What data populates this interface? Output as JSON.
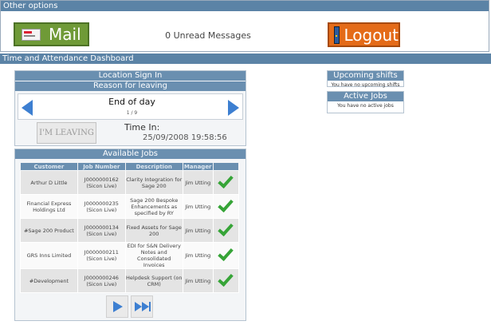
{
  "header": {
    "title": "Other options",
    "mail_label": "Mail",
    "unread": "0 Unread Messages",
    "logout_label": "Logout"
  },
  "dashboard": {
    "title": "Time and Attendance Dashboard"
  },
  "signin": {
    "title": "Location Sign In",
    "reason_title": "Reason for leaving",
    "reason_value": "End of day",
    "reason_count": "1 / 9",
    "leave_button": "I'M LEAVING",
    "time_in_label": "Time In:",
    "time_in_value": "25/09/2008 19:58:56"
  },
  "upcoming": {
    "title": "Upcoming shifts",
    "message": "You have no upcoming shifts"
  },
  "active": {
    "title": "Active Jobs",
    "message": "You have no active jobs"
  },
  "jobs": {
    "title": "Available Jobs",
    "columns": [
      "Customer",
      "Job Number",
      "Description",
      "Manager"
    ],
    "rows": [
      {
        "customer": "Arthur D Little",
        "job": "J0000000162 (Sicon Live)",
        "desc": "Clarity Integration for Sage 200",
        "manager": "Jim Utting"
      },
      {
        "customer": "Financial Express Holdings Ltd",
        "job": "J0000000235 (Sicon Live)",
        "desc": "Sage 200 Bespoke Enhancements as specified by RY",
        "manager": "Jim Utting"
      },
      {
        "customer": "#Sage 200 Product",
        "job": "J0000000134 (Sicon Live)",
        "desc": "Fixed Assets for Sage 200",
        "manager": "Jim Utting"
      },
      {
        "customer": "GRS Inns Limited",
        "job": "J0000000211 (Sicon Live)",
        "desc": "EDI for S&N Delivery Notes and Consolidated Invoices",
        "manager": "Jim Utting"
      },
      {
        "customer": "#Development",
        "job": "J0000000246 (Sicon Live)",
        "desc": "Helpdesk Support (on CRM)",
        "manager": "Jim Utting"
      }
    ]
  },
  "icons": {
    "mail": "envelope-icon",
    "logout": "door-icon",
    "prev": "arrow-left-icon",
    "next": "arrow-right-icon",
    "select": "checkmark-icon",
    "last": "last-page-icon"
  },
  "colors": {
    "header_bar": "#5b83a6",
    "mail_button": "#6f9a37",
    "logout_button": "#e46b18",
    "arrow": "#3d7fd1",
    "check": "#36a437"
  }
}
